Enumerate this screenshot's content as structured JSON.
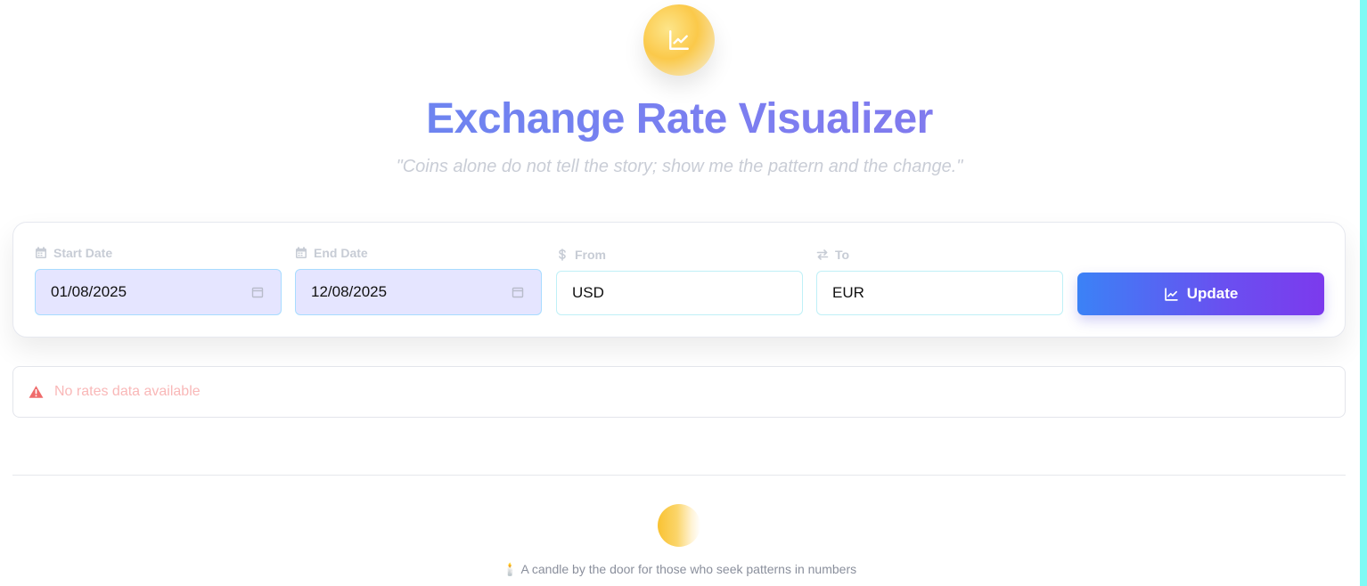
{
  "header": {
    "logo_icon": "chart-line-icon",
    "title": "Exchange Rate Visualizer",
    "quote": "\"Coins alone do not tell the story; show me the pattern and the change.\""
  },
  "controls": {
    "start_date": {
      "label": "Start Date",
      "value": "01/08/2025",
      "icon": "calendar-icon"
    },
    "end_date": {
      "label": "End Date",
      "value": "12/08/2025",
      "icon": "calendar-icon"
    },
    "from": {
      "label": "From",
      "value": "USD",
      "icon": "dollar-icon"
    },
    "to": {
      "label": "To",
      "value": "EUR",
      "icon": "exchange-arrows-icon"
    },
    "update_button": {
      "label": "Update",
      "icon": "chart-line-icon"
    }
  },
  "alert": {
    "icon": "warning-icon",
    "message": "No rates data available"
  },
  "footer": {
    "text": "🕯️ A candle by the door for those who seek patterns in numbers"
  },
  "colors": {
    "accent_gradient_start": "#3b82f6",
    "accent_gradient_end": "#7c3aed",
    "title_gradient_start": "#5b8cf1",
    "title_gradient_end": "#8a73ea",
    "date_input_bg": "#e5e5ff",
    "alert_text": "#f9b8b8",
    "alert_icon": "#ef6b6b",
    "gold": "#fbc94a"
  }
}
